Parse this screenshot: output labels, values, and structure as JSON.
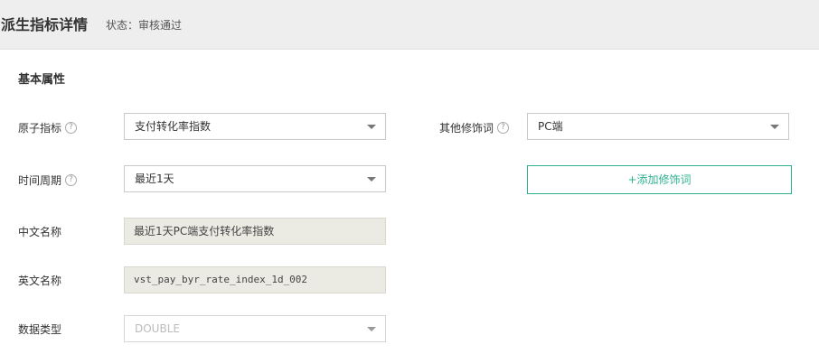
{
  "header": {
    "title": "派生指标详情",
    "status": "状态：审核通过"
  },
  "section": {
    "title": "基本属性"
  },
  "fields": {
    "atomic_metric": {
      "label": "原子指标",
      "value": "支付转化率指数"
    },
    "time_period": {
      "label": "时间周期",
      "value": "最近1天"
    },
    "cn_name": {
      "label": "中文名称",
      "value": "最近1天PC端支付转化率指数"
    },
    "en_name": {
      "label": "英文名称",
      "value": "vst_pay_byr_rate_index_1d_002"
    },
    "data_type": {
      "label": "数据类型",
      "value": "DOUBLE"
    },
    "other_modifier": {
      "label": "其他修饰词",
      "value": "PC端"
    }
  },
  "buttons": {
    "add_modifier": "+添加修饰词"
  },
  "icons": {
    "help": "help-icon",
    "dropdown": "chevron-down-icon"
  },
  "colors": {
    "accent": "#2fb18f",
    "header_bg": "#eeeeee",
    "readonly_bg": "#ebebe4"
  }
}
